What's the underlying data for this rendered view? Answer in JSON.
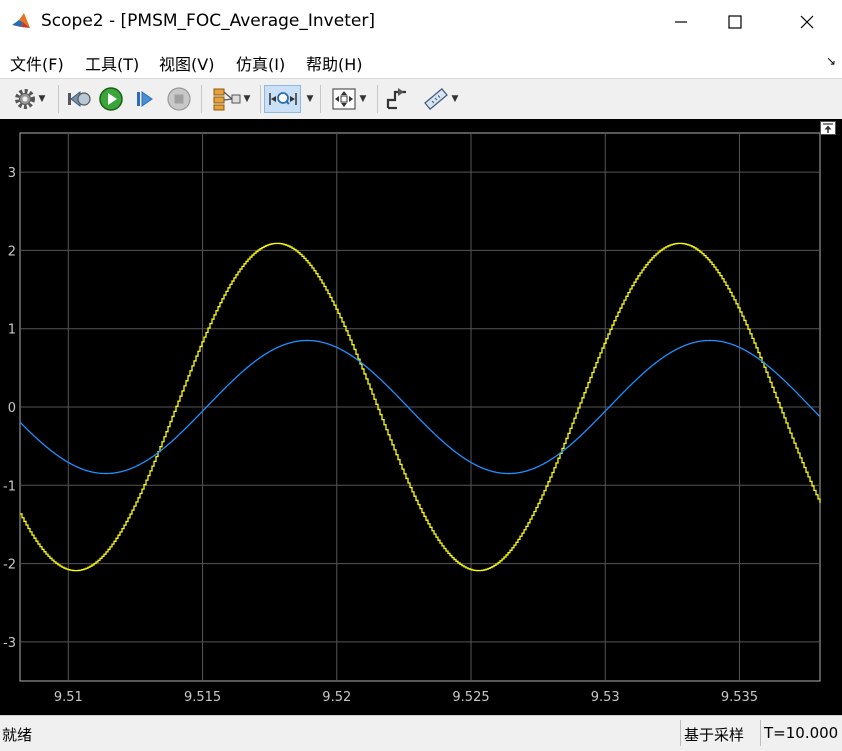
{
  "window": {
    "title": "Scope2 - [PMSM_FOC_Average_Inveter]",
    "app_icon": "matlab-logo-icon",
    "controls": [
      "minimize-icon",
      "maximize-icon",
      "close-icon"
    ]
  },
  "menu": {
    "items": [
      {
        "label": "文件(F)"
      },
      {
        "label": "工具(T)"
      },
      {
        "label": "视图(V)"
      },
      {
        "label": "仿真(I)"
      },
      {
        "label": "帮助(H)"
      }
    ],
    "dock_arrow": "↘"
  },
  "toolbar": {
    "icons": [
      "settings-gear-icon",
      "step-back-icon",
      "run-icon",
      "step-forward-icon",
      "stop-icon",
      "signal-selector-icon",
      "zoom-icon",
      "autoscale-icon",
      "triggers-icon",
      "measurements-icon"
    ]
  },
  "status": {
    "left": "就绪",
    "mid": "基于采样",
    "right": "T=10.000"
  },
  "chart_data": {
    "type": "line",
    "background": "#000000",
    "grid": true,
    "xlim": [
      9.5082,
      9.538
    ],
    "ylim": [
      -3.5,
      3.5
    ],
    "x_ticks": [
      9.51,
      9.515,
      9.52,
      9.525,
      9.53,
      9.535
    ],
    "x_tick_labels": [
      "9.51",
      "9.515",
      "9.52",
      "9.525",
      "9.53",
      "9.535"
    ],
    "y_ticks": [
      -3,
      -2,
      -1,
      0,
      1,
      2,
      3
    ],
    "y_tick_labels": [
      "-3",
      "-2",
      "-1",
      "0",
      "1",
      "2",
      "3"
    ],
    "series": [
      {
        "color": "#ffff00",
        "amplitude": 2.09,
        "period": 0.015,
        "peak_x": 9.51775,
        "stepped": true
      },
      {
        "color": "#1e90ff",
        "amplitude": 0.85,
        "period": 0.015,
        "peak_x": 9.5189,
        "stepped": false
      }
    ]
  }
}
